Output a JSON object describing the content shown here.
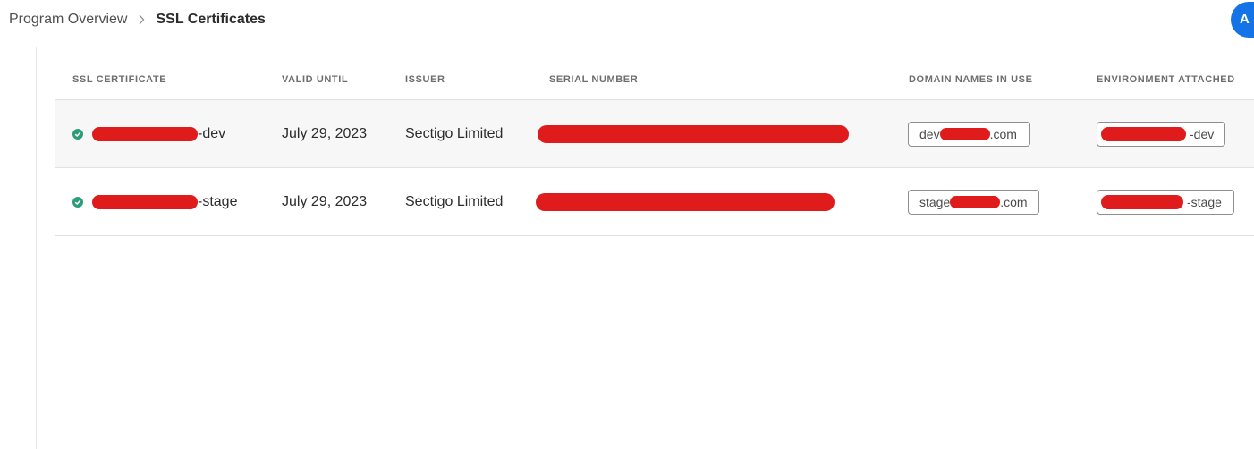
{
  "breadcrumb": {
    "parent": "Program Overview",
    "current": "SSL Certificates"
  },
  "cta": {
    "label": "A"
  },
  "table": {
    "columns": [
      "SSL CERTIFICATE",
      "VALID UNTIL",
      "ISSUER",
      "SERIAL NUMBER",
      "DOMAIN NAMES IN USE",
      "ENVIRONMENT ATTACHED"
    ],
    "rows": [
      {
        "certificate_suffix": "-dev",
        "valid_until": "July 29, 2023",
        "issuer": "Sectigo Limited",
        "domain_prefix": "dev",
        "domain_suffix": ".com",
        "environment_suffix": "-dev",
        "status": "valid"
      },
      {
        "certificate_suffix": "-stage",
        "valid_until": "July 29, 2023",
        "issuer": "Sectigo Limited",
        "domain_prefix": "stage",
        "domain_suffix": ".com",
        "environment_suffix": "-stage",
        "status": "valid"
      }
    ]
  },
  "colors": {
    "accent": "#1473e6",
    "status_valid": "#2d9d78",
    "redaction": "#e01b1b",
    "row_alt": "#f7f7f7"
  },
  "icons": {
    "breadcrumb_separator": "chevron-right-icon",
    "status": "check-circle-icon"
  }
}
